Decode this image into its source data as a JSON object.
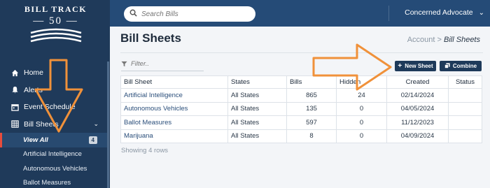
{
  "logo": {
    "line1": "BILL TRACK",
    "line2": "50"
  },
  "topbar": {
    "search_placeholder": "Search Bills",
    "user": "Concerned Advocate"
  },
  "sidebar": {
    "items": [
      {
        "label": "Home",
        "icon": "home-icon"
      },
      {
        "label": "Alerts",
        "icon": "bell-icon"
      },
      {
        "label": "Event Schedule",
        "icon": "calendar-icon"
      },
      {
        "label": "Bill Sheets",
        "icon": "grid-icon"
      }
    ],
    "subitems": [
      {
        "label": "View All",
        "badge": "4"
      },
      {
        "label": "Artificial Intelligence"
      },
      {
        "label": "Autonomous Vehicles"
      },
      {
        "label": "Ballot Measures"
      }
    ]
  },
  "main": {
    "title": "Bill Sheets",
    "breadcrumb_root": "Account",
    "breadcrumb_sep": ">",
    "breadcrumb_current": "Bill Sheets",
    "filter_placeholder": "Filter..",
    "new_sheet": "New Sheet",
    "combine": "Combine",
    "columns": [
      "Bill Sheet",
      "States",
      "Bills",
      "Hidden",
      "Created",
      "Status"
    ],
    "rows": [
      [
        "Artificial Intelligence",
        "All States",
        "865",
        "24",
        "02/14/2024",
        ""
      ],
      [
        "Autonomous Vehicles",
        "All States",
        "135",
        "0",
        "04/05/2024",
        ""
      ],
      [
        "Ballot Measures",
        "All States",
        "597",
        "0",
        "11/12/2023",
        ""
      ],
      [
        "Marijuana",
        "All States",
        "8",
        "0",
        "04/09/2024",
        ""
      ]
    ],
    "footer": "Showing 4 rows"
  },
  "colors": {
    "sidebar": "#1f3a5a",
    "topbar": "#254b77",
    "button": "#1e3a5a",
    "annotation_arrow": "#f0913a",
    "active_marker": "#e74c3c"
  }
}
